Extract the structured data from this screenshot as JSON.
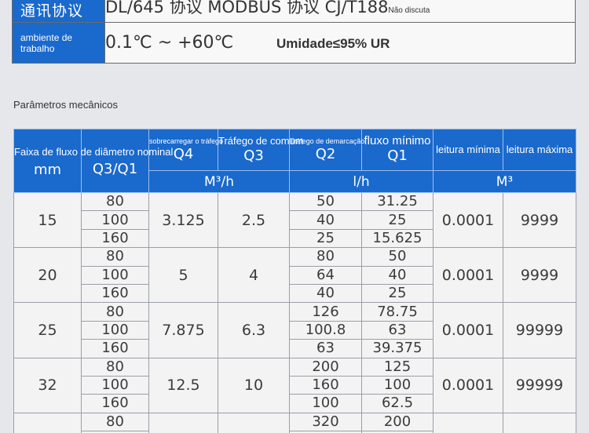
{
  "top_table": {
    "protocol": {
      "label": "通讯协议",
      "value": "DL/645 协议   MODBUS 协议   CJ/T188",
      "note": "Não discuta"
    },
    "environment": {
      "label": "ambiente de trabalho",
      "temperature": "0.1℃ ~ +60℃",
      "humidity": "Umidade≤95% UR"
    }
  },
  "section_title": "Parâmetros mecânicos",
  "table": {
    "headers": {
      "diameter": "Faixa de fluxo de diâmetro nominal",
      "diameter_unit": "mm",
      "ratio": "Q3/Q1",
      "overload": "sobrecarregar o tráfego",
      "overload_sym": "Q4",
      "common": "Tráfego de comum",
      "common_sym": "Q3",
      "demarcation": "Tráfego de demarcação",
      "demarcation_sym": "Q2",
      "min_flow": "fluxo mínimo",
      "min_flow_sym": "Q1",
      "min_reading": "leitura mínima",
      "max_reading": "leitura máxima",
      "unit_q4q3": "M³/h",
      "unit_q2q1": "l/h",
      "unit_reading": "M³"
    },
    "groups": [
      {
        "dn": "15",
        "q4": "3.125",
        "q3": "2.5",
        "min_reading": "0.0001",
        "max_reading": "9999",
        "rows": [
          {
            "ratio": "80",
            "q2": "50",
            "q1": "31.25"
          },
          {
            "ratio": "100",
            "q2": "40",
            "q1": "25"
          },
          {
            "ratio": "160",
            "q2": "25",
            "q1": "15.625"
          }
        ]
      },
      {
        "dn": "20",
        "q4": "5",
        "q3": "4",
        "min_reading": "0.0001",
        "max_reading": "9999",
        "rows": [
          {
            "ratio": "80",
            "q2": "80",
            "q1": "50"
          },
          {
            "ratio": "100",
            "q2": "64",
            "q1": "40"
          },
          {
            "ratio": "160",
            "q2": "40",
            "q1": "25"
          }
        ]
      },
      {
        "dn": "25",
        "q4": "7.875",
        "q3": "6.3",
        "min_reading": "0.0001",
        "max_reading": "99999",
        "rows": [
          {
            "ratio": "80",
            "q2": "126",
            "q1": "78.75"
          },
          {
            "ratio": "100",
            "q2": "100.8",
            "q1": "63"
          },
          {
            "ratio": "160",
            "q2": "63",
            "q1": "39.375"
          }
        ]
      },
      {
        "dn": "32",
        "q4": "12.5",
        "q3": "10",
        "min_reading": "0.0001",
        "max_reading": "99999",
        "rows": [
          {
            "ratio": "80",
            "q2": "200",
            "q1": "125"
          },
          {
            "ratio": "100",
            "q2": "160",
            "q1": "100"
          },
          {
            "ratio": "160",
            "q2": "100",
            "q1": "62.5"
          }
        ]
      },
      {
        "dn": "",
        "q4": "",
        "q3": "",
        "min_reading": "",
        "max_reading": "",
        "rows": [
          {
            "ratio": "80",
            "q2": "320",
            "q1": "200"
          },
          {
            "ratio": "",
            "q2": "",
            "q1": ""
          }
        ]
      }
    ]
  }
}
